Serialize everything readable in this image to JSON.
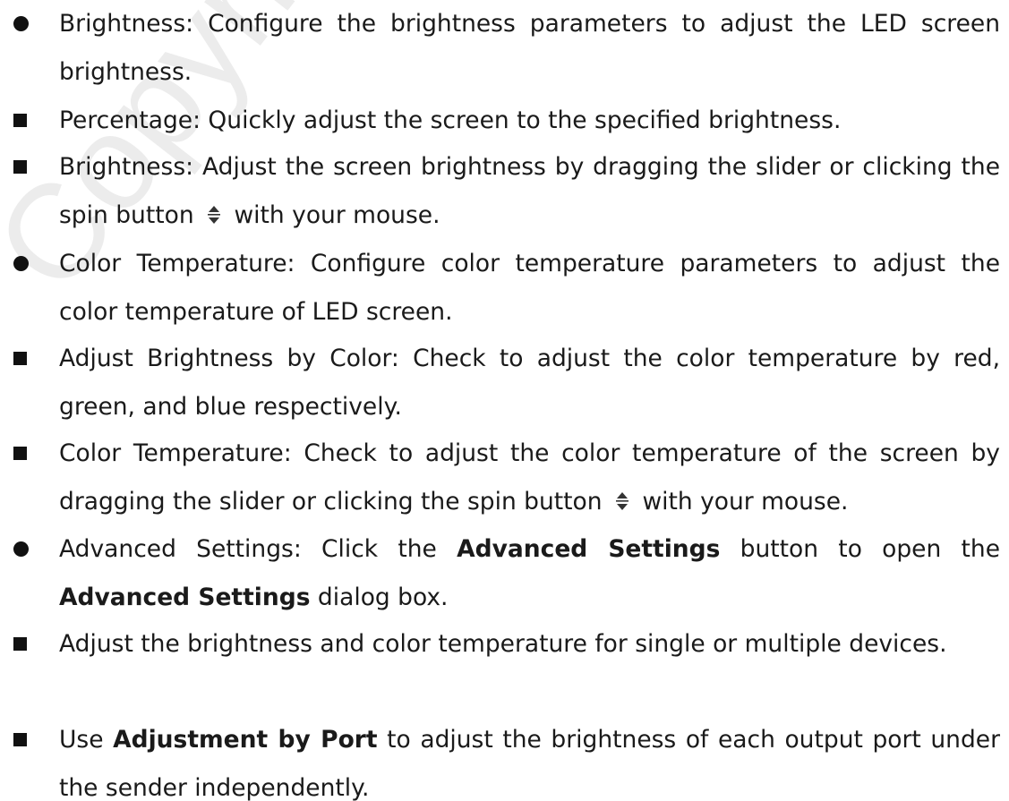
{
  "watermark": "Copyright Cloud",
  "items": [
    {
      "type": "dot",
      "text": "Brightness: Configure the brightness parameters to adjust the LED screen brightness."
    },
    {
      "type": "square",
      "text": "Percentage: Quickly adjust the screen to the specified brightness."
    },
    {
      "type": "square",
      "before": "Brightness: Adjust the screen brightness by dragging the slider or clicking the spin button",
      "after": "with your mouse.",
      "icon": "spin-button-icon"
    },
    {
      "type": "dot",
      "text": "Color Temperature: Configure color temperature parameters to adjust the color temperature of LED screen."
    },
    {
      "type": "square",
      "text": "Adjust Brightness by Color: Check to adjust the color temperature by red, green, and blue respectively."
    },
    {
      "type": "square",
      "before": "Color Temperature: Check to adjust the color temperature of the screen by dragging the slider or clicking the spin button",
      "after": "with your mouse.",
      "icon": "spin-button-icon"
    },
    {
      "type": "dot",
      "pre": "Advanced Settings: Click the",
      "bold1": "Advanced Settings",
      "mid": "button to open the",
      "bold2": "Advanced Settings",
      "post": "dialog box."
    },
    {
      "type": "square",
      "text": "Adjust the brightness and color temperature for single or multiple devices."
    },
    {
      "type": "square",
      "pre": "Use",
      "bold1": "Adjustment by Port",
      "post": "to adjust the brightness of each output port under the sender independently."
    }
  ]
}
